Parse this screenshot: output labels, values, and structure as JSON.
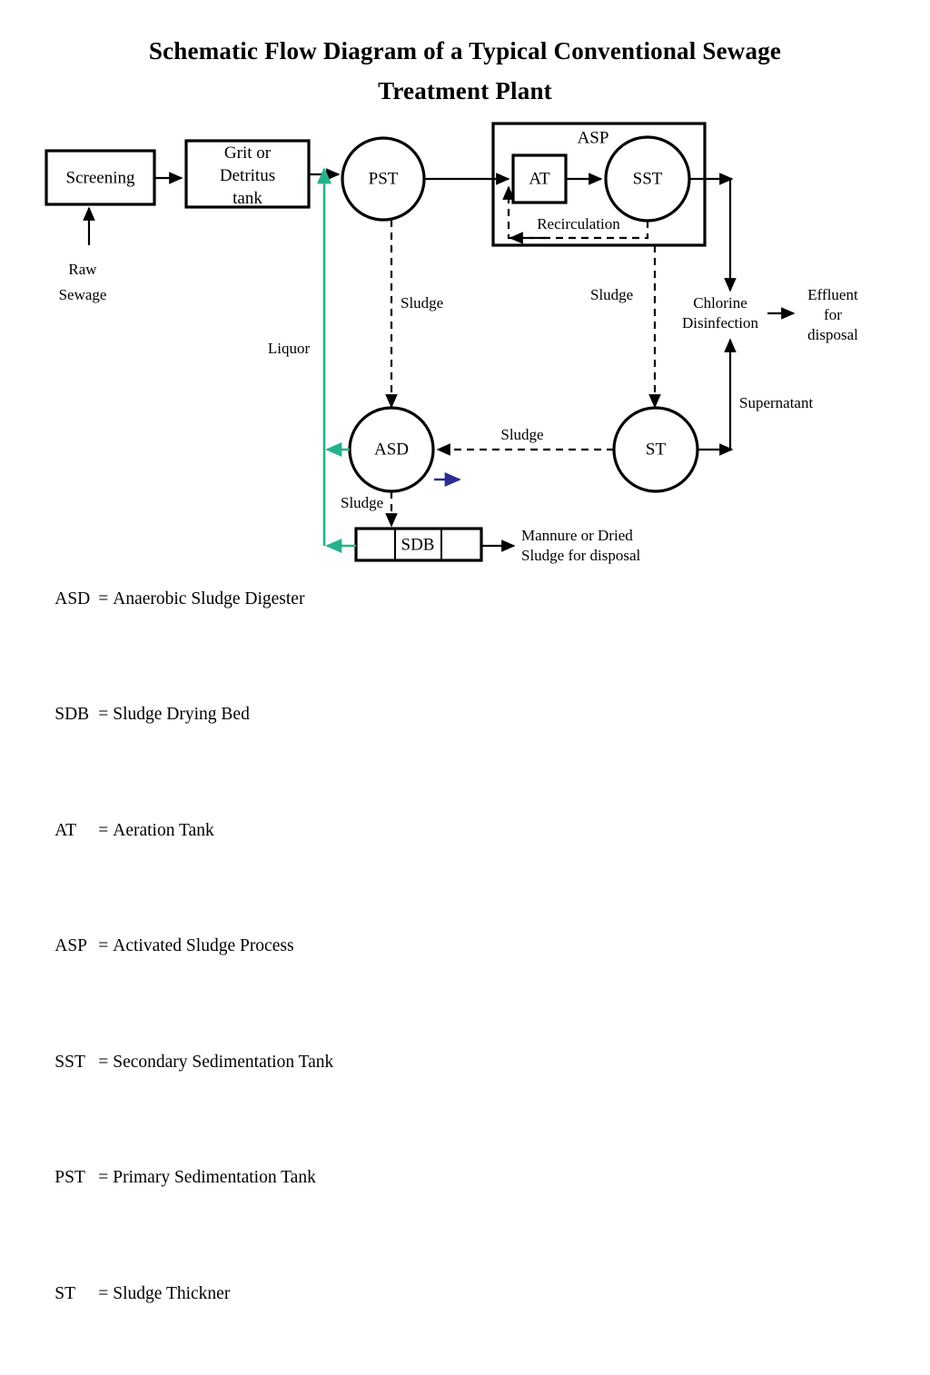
{
  "title": {
    "line1": "Schematic Flow  Diagram of a Typical Conventional Sewage",
    "line2": "Treatment Plant"
  },
  "colors": {
    "stroke": "#000000",
    "liquor_green": "#25b18c",
    "blue_arrow": "#2d2d8f",
    "background": "#ffffff"
  },
  "nodes": {
    "screening": "Screening",
    "grit_line1": "Grit or",
    "grit_line2": "Detritus",
    "grit_line3": "tank",
    "pst": "PST",
    "asp": "ASP",
    "at": "AT",
    "sst": "SST",
    "asd": "ASD",
    "st": "ST",
    "sdb": "SDB"
  },
  "flow_labels": {
    "raw_sewage_line1": "Raw",
    "raw_sewage_line2": "Sewage",
    "recirculation": "Recirculation",
    "sludge_pst": "Sludge",
    "sludge_sst": "Sludge",
    "sludge_st_asd": "Sludge",
    "sludge_asd_sdb": "Sludge",
    "liquor": "Liquor",
    "supernatant": "Supernatant",
    "chlorine_line1": "Chlorine",
    "chlorine_line2": "Disinfection",
    "effluent_line1": "Effluent",
    "effluent_line2": "for",
    "effluent_line3": "disposal",
    "manure_line1": "Mannure or Dried",
    "manure_line2": "Sludge for disposal"
  },
  "legend": [
    {
      "abbr": "ASD",
      "eq": "=",
      "text": "Anaerobic Sludge Digester"
    },
    {
      "abbr": "SDB",
      "eq": "=",
      "text": "Sludge Drying Bed"
    },
    {
      "abbr": "AT",
      "eq": "=",
      "text": "Aeration Tank"
    },
    {
      "abbr": "ASP",
      "eq": "=",
      "text": "Activated Sludge Process"
    },
    {
      "abbr": "SST",
      "eq": "=",
      "text": "Secondary Sedimentation Tank"
    },
    {
      "abbr": "PST",
      "eq": "=",
      "text": "Primary Sedimentation Tank"
    },
    {
      "abbr": "ST",
      "eq": "=",
      "text": "Sludge Thickner"
    }
  ],
  "chart_data": {
    "type": "diagram",
    "title": "Schematic Flow  Diagram of a Typical Conventional Sewage Treatment Plant",
    "nodes": [
      {
        "id": "screening",
        "label": "Screening",
        "shape": "rect"
      },
      {
        "id": "grit",
        "label": "Grit or Detritus tank",
        "shape": "rect"
      },
      {
        "id": "pst",
        "label": "PST",
        "shape": "circle"
      },
      {
        "id": "asp",
        "label": "ASP",
        "shape": "rect-group"
      },
      {
        "id": "at",
        "label": "AT",
        "shape": "rect"
      },
      {
        "id": "sst",
        "label": "SST",
        "shape": "circle"
      },
      {
        "id": "chlorine",
        "label": "Chlorine Disinfection",
        "shape": "text"
      },
      {
        "id": "effluent",
        "label": "Effluent for disposal",
        "shape": "text"
      },
      {
        "id": "asd",
        "label": "ASD",
        "shape": "circle"
      },
      {
        "id": "st",
        "label": "ST",
        "shape": "circle"
      },
      {
        "id": "sdb",
        "label": "SDB",
        "shape": "rect-3cell"
      },
      {
        "id": "manure",
        "label": "Mannure or Dried Sludge for disposal",
        "shape": "text"
      }
    ],
    "edges": [
      {
        "from": "raw-sewage",
        "to": "screening",
        "label": "Raw Sewage",
        "style": "solid"
      },
      {
        "from": "screening",
        "to": "grit",
        "label": "",
        "style": "solid"
      },
      {
        "from": "grit",
        "to": "pst",
        "label": "",
        "style": "solid"
      },
      {
        "from": "pst",
        "to": "at",
        "label": "",
        "style": "solid"
      },
      {
        "from": "at",
        "to": "sst",
        "label": "",
        "style": "solid"
      },
      {
        "from": "sst",
        "to": "at",
        "label": "Recirculation",
        "style": "dashed"
      },
      {
        "from": "sst",
        "to": "chlorine",
        "label": "",
        "style": "solid"
      },
      {
        "from": "chlorine",
        "to": "effluent",
        "label": "",
        "style": "solid"
      },
      {
        "from": "pst",
        "to": "asd",
        "label": "Sludge",
        "style": "dashed"
      },
      {
        "from": "sst",
        "to": "st",
        "label": "Sludge",
        "style": "dashed"
      },
      {
        "from": "st",
        "to": "asd",
        "label": "Sludge",
        "style": "dashed"
      },
      {
        "from": "st",
        "to": "chlorine",
        "label": "Supernatant",
        "style": "solid"
      },
      {
        "from": "asd",
        "to": "sdb",
        "label": "Sludge",
        "style": "dashed"
      },
      {
        "from": "asd",
        "to": "pst",
        "label": "Liquor",
        "style": "solid-green"
      },
      {
        "from": "sdb",
        "to": "pst",
        "label": "Liquor",
        "style": "solid-green"
      },
      {
        "from": "sdb",
        "to": "manure",
        "label": "",
        "style": "solid"
      }
    ]
  }
}
